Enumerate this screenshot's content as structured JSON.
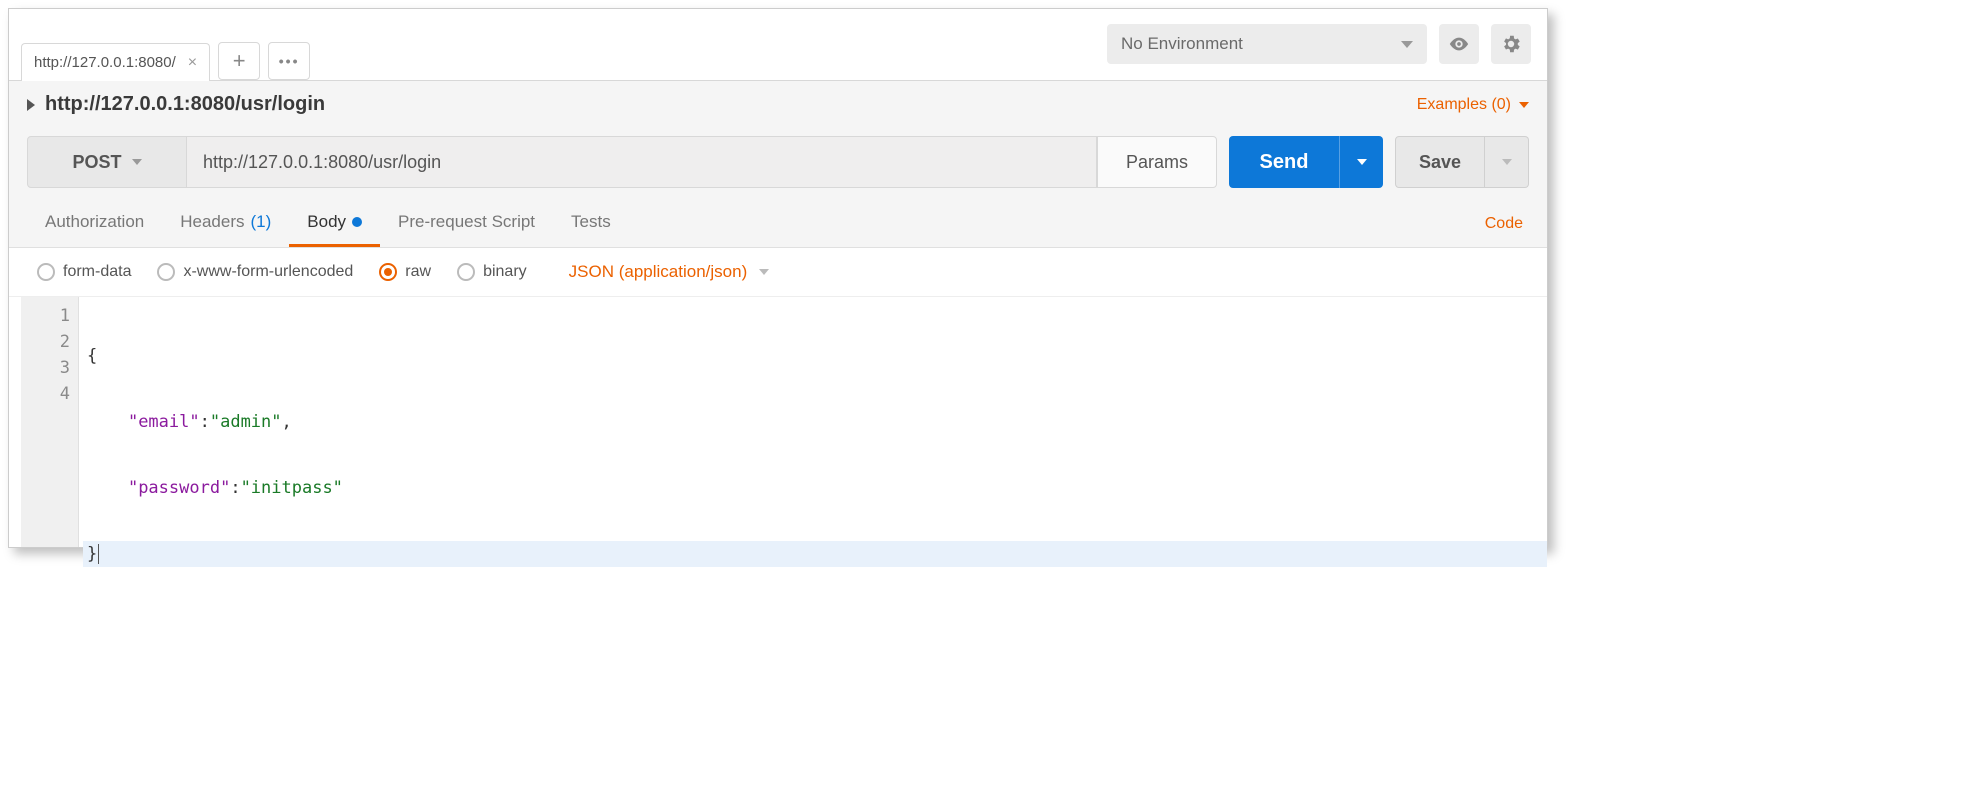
{
  "tabs": {
    "tab1_label": "http://127.0.0.1:8080/"
  },
  "env": {
    "label": "No Environment"
  },
  "request": {
    "title": "http://127.0.0.1:8080/usr/login",
    "method": "POST",
    "url": "http://127.0.0.1:8080/usr/login",
    "params_label": "Params",
    "send_label": "Send",
    "save_label": "Save",
    "examples_label": "Examples (0)"
  },
  "sectionTabs": {
    "authorization": "Authorization",
    "headers": "Headers",
    "headers_count": "(1)",
    "body": "Body",
    "prerequest": "Pre-request Script",
    "tests": "Tests",
    "code": "Code"
  },
  "bodyTypes": {
    "formdata": "form-data",
    "urlencoded": "x-www-form-urlencoded",
    "raw": "raw",
    "binary": "binary",
    "contentType": "JSON (application/json)"
  },
  "editor": {
    "line_numbers": [
      "1",
      "2",
      "3",
      "4"
    ],
    "line1": "{",
    "line2_key": "\"email\"",
    "line2_val": "\"admin\"",
    "line3_key": "\"password\"",
    "line3_val": "\"initpass\"",
    "line4": "}"
  }
}
